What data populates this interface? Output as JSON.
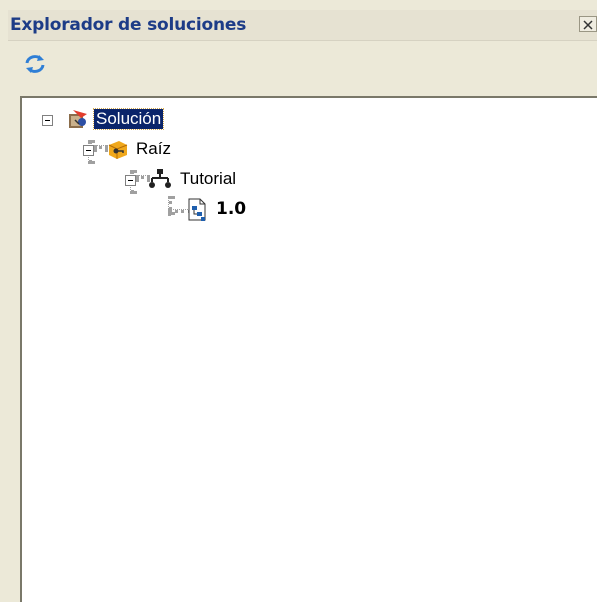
{
  "panel": {
    "title": "Explorador de soluciones",
    "close_glyph": "×"
  },
  "toolbar": {
    "refresh_icon": "refresh-icon"
  },
  "tree": {
    "nodes": [
      {
        "label": "Solución",
        "icon": "solution-icon",
        "selected": true,
        "expanded": true
      },
      {
        "label": "Raíz",
        "icon": "folder-key-icon",
        "expanded": true
      },
      {
        "label": "Tutorial",
        "icon": "hierarchy-icon",
        "expanded": true
      },
      {
        "label": "1.0",
        "icon": "document-icon",
        "bold": true
      }
    ]
  },
  "colors": {
    "title_text": "#1d3c87",
    "selection_bg": "#0a246a",
    "window_bg": "#ece9d8"
  }
}
